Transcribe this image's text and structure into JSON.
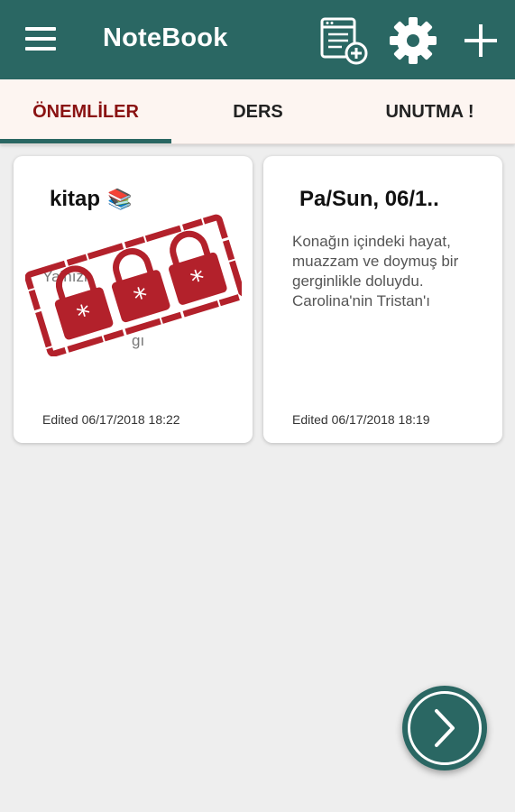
{
  "app": {
    "title": "NoteBook",
    "accent_color": "#2a6763",
    "active_tab_color": "#8a1212"
  },
  "toolbar": {
    "menu_icon": "hamburger-menu-icon",
    "new_note_icon": "new-note-icon",
    "settings_icon": "gear-icon",
    "add_icon": "plus-icon"
  },
  "tabs": [
    {
      "label": "ÖNEMLİLER",
      "active": true
    },
    {
      "label": "DERS",
      "active": false
    },
    {
      "label": "UNUTMA !",
      "active": false
    }
  ],
  "notes": [
    {
      "title": "kitap",
      "title_emoji": "📚",
      "body_line_1": "Yalnızk",
      "body_line_2": "gı",
      "locked": true,
      "lock_icon": "padlock-stamp-icon",
      "edited": "Edited 06/17/2018 18:22"
    },
    {
      "title": "Pa/Sun, 06/1..",
      "body": "Konağın içindeki hayat, muazzam ve doymuş bir gerginlikle doluydu. Carolina'nin Tristan'ı",
      "locked": false,
      "edited": "Edited 06/17/2018 18:19"
    }
  ],
  "fab": {
    "icon": "chevron-right-icon"
  }
}
